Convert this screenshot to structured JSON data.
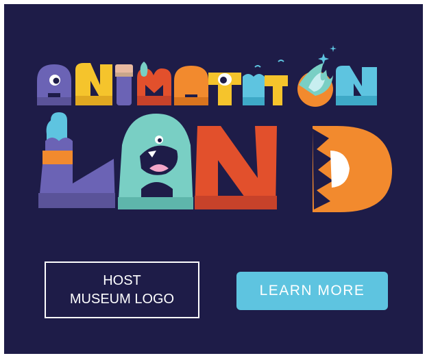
{
  "logo": {
    "line1": [
      "A",
      "N",
      "I",
      "M",
      "A",
      "T",
      "I",
      "O",
      "N"
    ],
    "line2": [
      "L",
      "A",
      "N",
      "D"
    ],
    "colors": {
      "background": "#1e1c48",
      "purple": "#6b63b5",
      "orange": "#f28a2e",
      "red": "#e2502c",
      "yellow": "#f5c42c",
      "teal": "#79cfc4",
      "sky": "#5ec4e0"
    }
  },
  "host_logo": {
    "line1": "HOST",
    "line2": "MUSEUM LOGO"
  },
  "cta": {
    "label": "LEARN MORE",
    "color": "#5ec4e0"
  }
}
